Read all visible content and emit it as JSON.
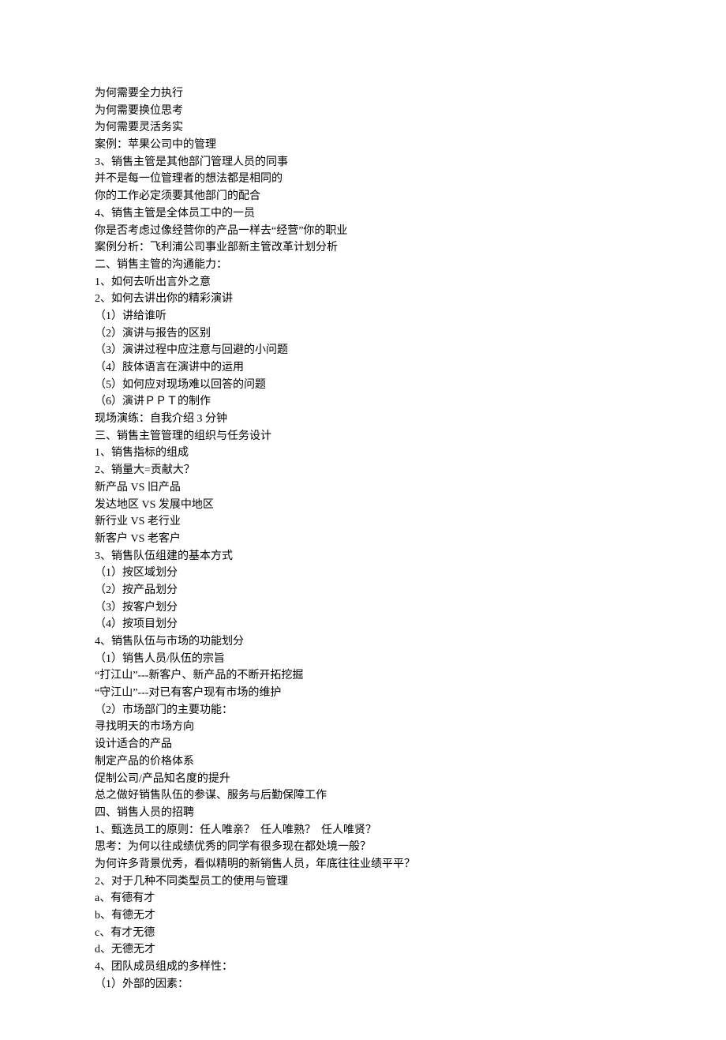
{
  "lines": [
    "为何需要全力执行",
    "为何需要换位思考",
    "为何需要灵活务实",
    "案例：苹果公司中的管理",
    "3、销售主管是其他部门管理人员的同事",
    "并不是每一位管理者的想法都是相同的",
    "你的工作必定须要其他部门的配合",
    "4、销售主管是全体员工中的一员",
    "你是否考虑过像经营你的产品一样去“经营”你的职业",
    "案例分析：飞利浦公司事业部新主管改革计划分析",
    "二、销售主管的沟通能力：",
    "1、如何去听出言外之意",
    "2、如何去讲出你的精彩演讲",
    "（1）讲给谁听",
    "（2）演讲与报告的区别",
    "（3）演讲过程中应注意与回避的小问题",
    "（4）肢体语言在演讲中的运用",
    "（5）如何应对现场难以回答的问题",
    "（6）演讲ＰＰＴ的制作",
    "现场演练：自我介绍 3 分钟",
    "三、销售主管管理的组织与任务设计",
    "1、销售指标的组成",
    "2、销量大=贡献大？",
    "新产品 VS 旧产品",
    "发达地区 VS 发展中地区",
    "新行业 VS 老行业",
    "新客户 VS 老客户",
    "3、销售队伍组建的基本方式",
    "（1）按区域划分",
    "（2）按产品划分",
    "（3）按客户划分",
    "（4）按项目划分",
    "4、销售队伍与市场的功能划分",
    "（1）销售人员/队伍的宗旨",
    "“打江山”---新客户、新产品的不断开拓挖掘",
    "“守江山”---对已有客户现有市场的维护",
    "（2）市场部门的主要功能：",
    "寻找明天的市场方向",
    "设计适合的产品",
    "制定产品的价格体系",
    "促制公司/产品知名度的提升",
    "总之做好销售队伍的参谋、服务与后勤保障工作",
    "四、销售人员的招聘",
    "1、甄选员工的原则：任人唯亲？  任人唯熟？  任人唯贤？",
    "思考：为何以往成绩优秀的同学有很多现在都处境一般？",
    "为何许多背景优秀，看似精明的新销售人员，年底往往业绩平平？",
    "2、对于几种不同类型员工的使用与管理",
    "a、有德有才",
    "b、有德无才",
    "c、有才无德",
    "d、无德无才",
    "4、团队成员组成的多样性：",
    "（1）外部的因素："
  ]
}
